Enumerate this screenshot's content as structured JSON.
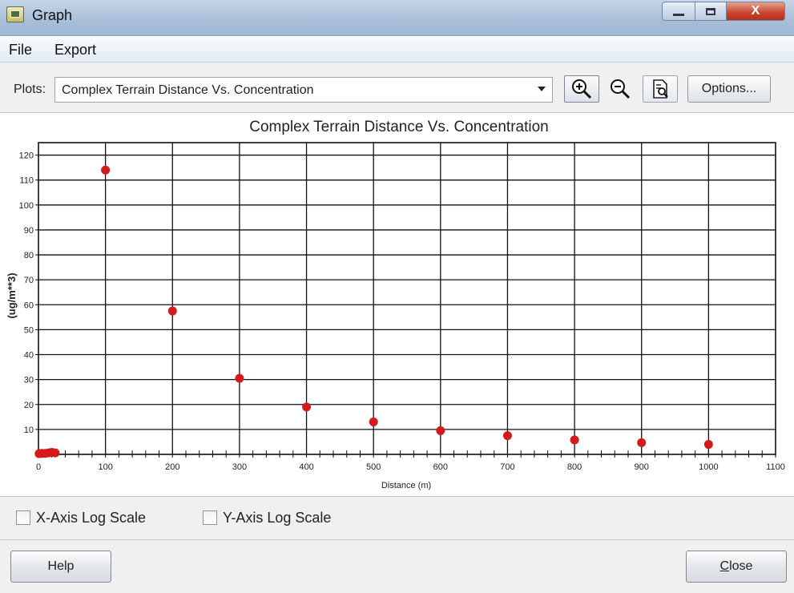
{
  "window": {
    "title": "Graph",
    "close_glyph": "X",
    "icons": [
      "app-icon",
      "minimize-icon",
      "maximize-icon",
      "close-icon"
    ]
  },
  "menu": {
    "file": "File",
    "export": "Export"
  },
  "toolbar": {
    "plots_label": "Plots:",
    "plots_selected": "Complex Terrain Distance Vs. Concentration",
    "options_label": "Options...",
    "icons": [
      "zoom-in-icon",
      "zoom-out-icon",
      "print-preview-icon",
      "chevron-down-icon"
    ]
  },
  "chart_data": {
    "type": "scatter",
    "title": "Complex Terrain Distance Vs. Concentration",
    "xlabel": "Distance (m)",
    "ylabel": "(ug/m**3)",
    "xlim": [
      0,
      1100
    ],
    "ylim": [
      0,
      125
    ],
    "xticks": [
      0,
      100,
      200,
      300,
      400,
      500,
      600,
      700,
      800,
      900,
      1000,
      1100
    ],
    "yticks": [
      10,
      20,
      30,
      40,
      50,
      60,
      70,
      80,
      90,
      100,
      110,
      120
    ],
    "grid": true,
    "marker_color": "#d41a1a",
    "series": [
      {
        "x": [
          1,
          5,
          10,
          15,
          20,
          25,
          100,
          200,
          300,
          400,
          500,
          600,
          700,
          800,
          900,
          1000
        ],
        "y": [
          0.3,
          0.4,
          0.4,
          0.6,
          0.8,
          0.6,
          114,
          57.5,
          30.5,
          19,
          13,
          9.5,
          7.5,
          5.8,
          4.7,
          4
        ]
      }
    ]
  },
  "options": {
    "x_log_label": "X-Axis Log Scale",
    "x_log_checked": false,
    "y_log_label": "Y-Axis Log Scale",
    "y_log_checked": false
  },
  "buttons": {
    "help": "Help",
    "close_first": "C",
    "close_rest": "lose"
  }
}
